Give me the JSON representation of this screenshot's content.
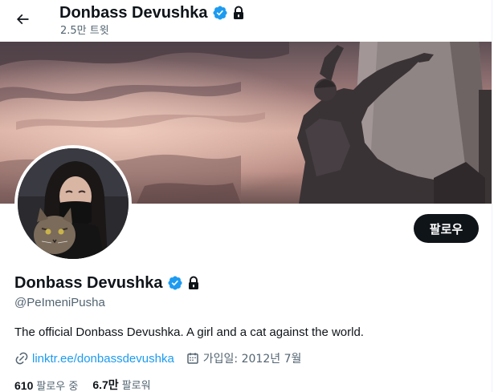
{
  "header": {
    "name": "Donbass Devushka",
    "tweet_count": "2.5만 트윗",
    "back_icon": "arrow-left-icon",
    "verified_icon": "verified-badge-icon",
    "lock_icon": "lock-icon"
  },
  "banner": {
    "image": "statue-banner"
  },
  "avatar": {
    "image": "avatar-girl-with-cat"
  },
  "profile": {
    "follow_label": "팔로우",
    "name": "Donbass Devushka",
    "handle": "@PeImeniPusha",
    "bio": "The official Donbass Devushka. A girl and a cat against the world.",
    "link": "linktr.ee/donbassdevushka",
    "joined": "가입일: 2012년 7월",
    "following_count": "610",
    "following_label": "팔로우 중",
    "followers_count": "6.7만",
    "followers_label": "팔로워"
  },
  "colors": {
    "accent": "#1d9bf0",
    "text": "#0f1419",
    "muted": "#536471",
    "button_bg": "#0f1419"
  }
}
